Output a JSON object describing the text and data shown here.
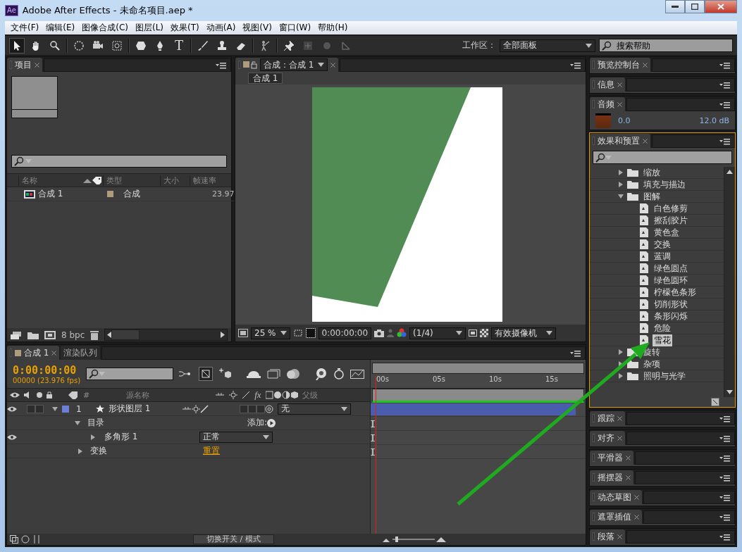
{
  "window": {
    "title": "Adobe After Effects - 未命名项目.aep *",
    "app_badge": "Ae"
  },
  "menu": [
    "文件(F)",
    "编辑(E)",
    "图像合成(C)",
    "图层(L)",
    "效果(T)",
    "动画(A)",
    "视图(V)",
    "窗口(W)",
    "帮助(H)"
  ],
  "toolbar": {
    "text_tool": "T",
    "workspace_label": "工作区：",
    "workspace": "全部面板",
    "search_placeholder": "搜索帮助"
  },
  "project": {
    "tab": "项目",
    "columns": [
      "名称",
      "类型",
      "大小",
      "帧速率"
    ],
    "items": [
      {
        "name": "合成 1",
        "type": "合成",
        "frame_rate": "23.97"
      }
    ],
    "bit_depth": "8 bpc"
  },
  "viewer": {
    "tab": "合成：合成 1",
    "comp_tab": "合成 1",
    "zoom": "25 %",
    "timecode": "0:00:00:00",
    "resolution": "(1/4)",
    "camera": "有效摄像机"
  },
  "timeline": {
    "tabs": [
      {
        "label": "合成 1",
        "selected": true
      },
      {
        "label": "渲染队列",
        "selected": false
      }
    ],
    "timecode": "0:00:00:00",
    "frame_info": "00000 (23.976 fps)",
    "columns": [
      "#",
      "源名称",
      "父级"
    ],
    "fx_label": "fx",
    "ruler": [
      "00s",
      "05s",
      "10s",
      "15s"
    ],
    "rows": [
      {
        "kind": "layer",
        "number": "1",
        "name": "形状图层 1",
        "parent": "无",
        "expanded": true,
        "switches": [
          {
            "on": false
          },
          {
            "on": false
          }
        ],
        "modes": [
          {
            "on": false
          },
          {
            "on": false
          },
          {
            "on": false
          }
        ]
      },
      {
        "kind": "group",
        "name": "目录",
        "action": "添加:",
        "expanded": true
      },
      {
        "kind": "shape",
        "name": "多角形 1",
        "mode": "正常",
        "expanded": false
      },
      {
        "kind": "property",
        "name": "变换",
        "link": "重置",
        "expanded": false
      }
    ],
    "footer": "切换开关 / 模式"
  },
  "panels": [
    {
      "kind": "collapsed",
      "title": "预览控制台"
    },
    {
      "kind": "collapsed",
      "title": "信息"
    },
    {
      "kind": "audio",
      "title": "音频",
      "reading": "0.0",
      "db": "12.0 dB"
    },
    {
      "kind": "effects",
      "title": "效果和预置",
      "tree": [
        {
          "name": "缩放",
          "expanded": false,
          "selected": false
        },
        {
          "name": "填充与描边",
          "expanded": false,
          "selected": false
        },
        {
          "name": "图解",
          "expanded": true,
          "selected": false,
          "children": [
            {
              "name": "白色修剪",
              "selected": false
            },
            {
              "name": "擦刮胶片",
              "selected": false
            },
            {
              "name": "黄色盒",
              "selected": false
            },
            {
              "name": "交换",
              "selected": false
            },
            {
              "name": "蓝调",
              "selected": false
            },
            {
              "name": "绿色圆点",
              "selected": false
            },
            {
              "name": "绿色圆环",
              "selected": false
            },
            {
              "name": "柠檬色条形",
              "selected": false
            },
            {
              "name": "切削形状",
              "selected": false
            },
            {
              "name": "条形闪烁",
              "selected": false
            },
            {
              "name": "危险",
              "selected": false
            },
            {
              "name": "雪花",
              "selected": true
            }
          ]
        },
        {
          "name": "旋转",
          "expanded": false,
          "selected": false
        },
        {
          "name": "杂项",
          "expanded": false,
          "selected": false
        },
        {
          "name": "照明与光学",
          "expanded": false,
          "selected": false
        }
      ]
    },
    {
      "kind": "collapsed",
      "title": "跟踪"
    },
    {
      "kind": "collapsed",
      "title": "对齐"
    },
    {
      "kind": "collapsed",
      "title": "平滑器"
    },
    {
      "kind": "collapsed",
      "title": "摇摆器"
    },
    {
      "kind": "collapsed",
      "title": "动态草图"
    },
    {
      "kind": "collapsed",
      "title": "遮罩插值"
    },
    {
      "kind": "collapsed",
      "title": "段落"
    }
  ]
}
